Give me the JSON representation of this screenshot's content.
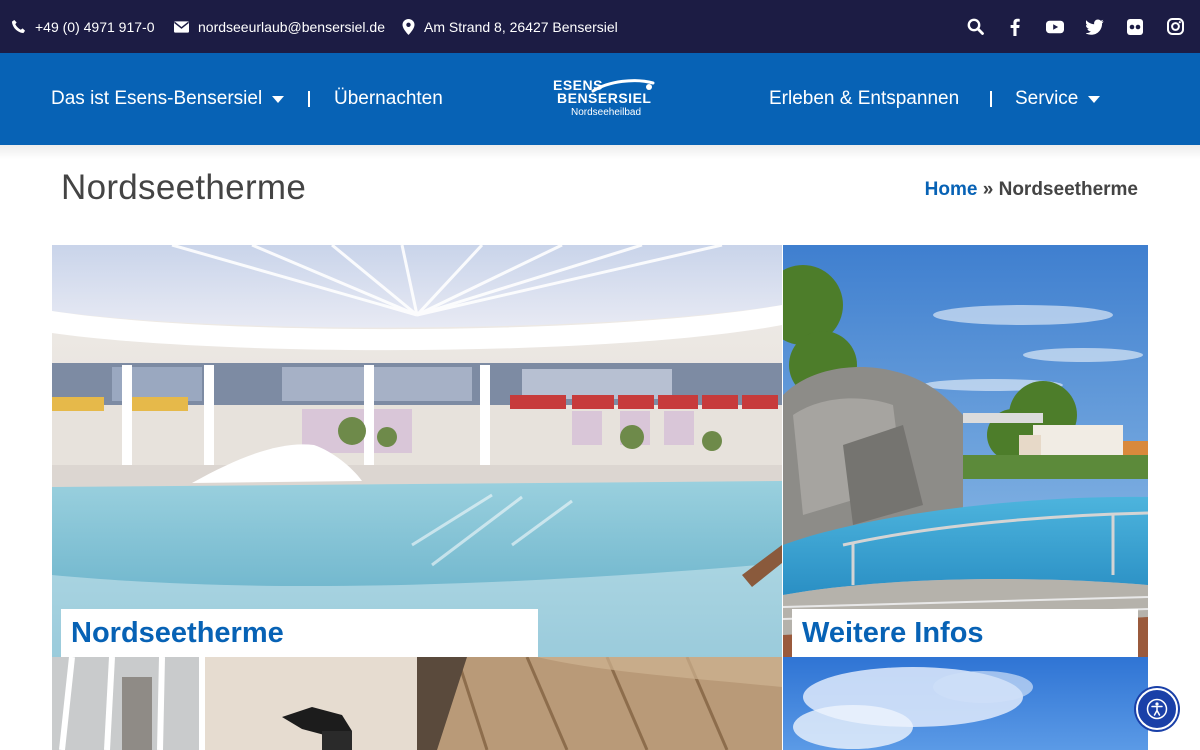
{
  "topbar": {
    "phone": "+49 (0) 4971 917-0",
    "email": "nordseeurlaub@bensersiel.de",
    "address": "Am Strand 8, 26427 Bensersiel",
    "social_icons": [
      "search-icon",
      "facebook-icon",
      "youtube-icon",
      "twitter-icon",
      "flickr-icon",
      "instagram-icon"
    ]
  },
  "nav": {
    "items": [
      {
        "label": "Das ist Esens-Bensersiel"
      },
      {
        "label": "Übernachten"
      },
      {
        "label": "Erleben & Entspannen"
      },
      {
        "label": "Service"
      }
    ],
    "logo": {
      "line1": "ESENS",
      "line2": "BENSERSIEL",
      "line3": "Nordseeheilbad"
    }
  },
  "page": {
    "title": "Nordseetherme",
    "breadcrumb": {
      "home": "Home",
      "separator": "»",
      "current": "Nordseetherme"
    }
  },
  "tiles": [
    {
      "label": "Nordseetherme"
    },
    {
      "label": "Weitere Infos"
    }
  ],
  "colors": {
    "topbar": "#1c1c44",
    "nav": "#0762b5",
    "accent": "#0762b5",
    "a11y_button": "#1a40a8"
  }
}
